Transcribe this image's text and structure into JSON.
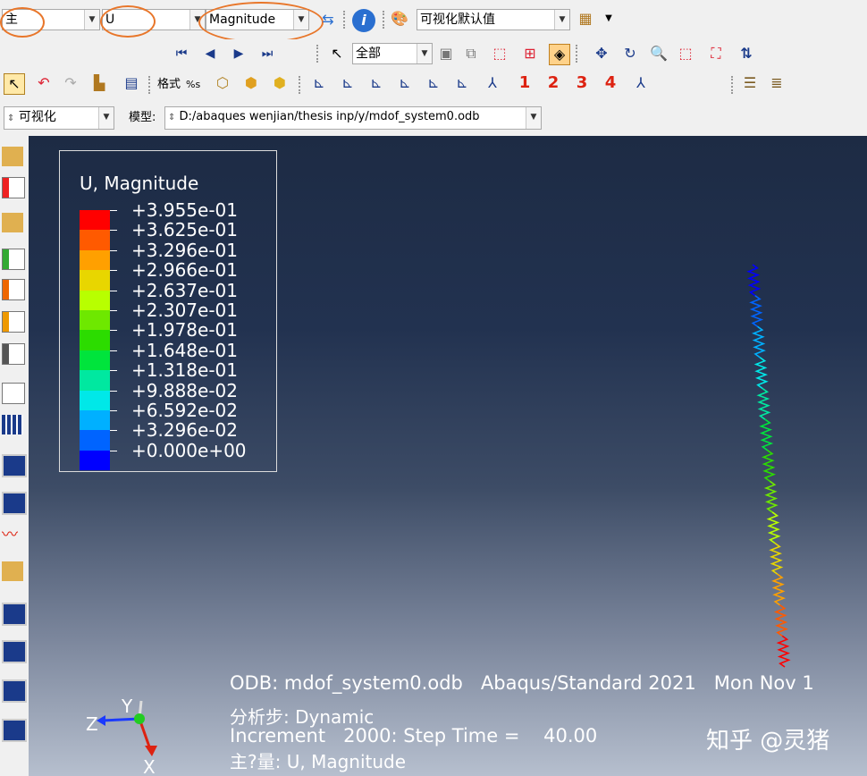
{
  "toolbar1": {
    "step_combo": "主",
    "variable_combo": "U",
    "component_combo": "Magnitude",
    "plot_options_combo": "可视化默认值"
  },
  "toolbar2": {
    "selection_combo": "全部"
  },
  "toolbar3": {
    "format_label": "格式",
    "format_placeholder": "%s",
    "viewport_numbers": [
      "1",
      "2",
      "3",
      "4"
    ]
  },
  "toolbar4": {
    "module_combo": "可视化",
    "model_label": "模型:",
    "model_path": "D:/abaques wenjian/thesis inp/y/mdof_system0.odb"
  },
  "legend": {
    "title": "U, Magnitude",
    "labels": [
      "+3.955e-01",
      "+3.625e-01",
      "+3.296e-01",
      "+2.966e-01",
      "+2.637e-01",
      "+2.307e-01",
      "+1.978e-01",
      "+1.648e-01",
      "+1.318e-01",
      "+9.888e-02",
      "+6.592e-02",
      "+3.296e-02",
      "+0.000e+00"
    ],
    "colors": [
      "#ff0000",
      "#ff5a00",
      "#ffa000",
      "#e8d600",
      "#b8ff00",
      "#6ee800",
      "#2cdc00",
      "#00e43c",
      "#00e8a0",
      "#00e8e8",
      "#00b0ff",
      "#0064ff",
      "#0000ff"
    ]
  },
  "info": {
    "odb_line": "ODB: mdof_system0.odb   Abaqus/Standard 2021   Mon Nov 1",
    "step_line": "分析步: Dynamic",
    "increment_line": "Increment   2000: Step Time =    40.00",
    "primary_var_line": "主?量: U, Magnitude"
  },
  "triad": {
    "x_label": "X",
    "y_label": "Y",
    "z_label": "Z"
  },
  "watermark": "知乎 @灵猪"
}
